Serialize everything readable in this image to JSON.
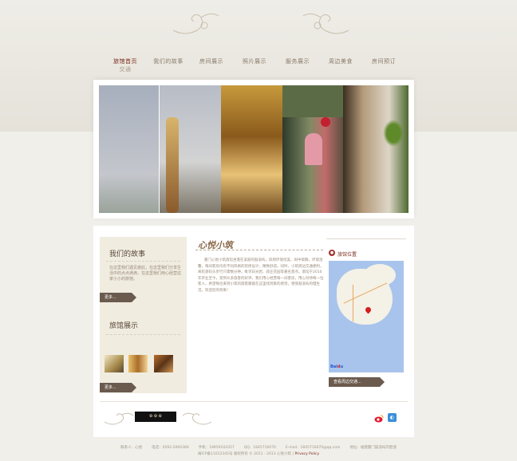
{
  "nav": {
    "items": [
      {
        "label": "旅馆首页",
        "sub": "交通"
      },
      {
        "label": "我们的故事",
        "sub": ""
      },
      {
        "label": "房间展示",
        "sub": ""
      },
      {
        "label": "照片展示",
        "sub": ""
      },
      {
        "label": "服务展示",
        "sub": ""
      },
      {
        "label": "周边美食",
        "sub": ""
      },
      {
        "label": "房间预订",
        "sub": ""
      }
    ]
  },
  "sidebar": {
    "story_title": "我们的故事",
    "story_text": "在这里我们遇见彼此，在这里我们分享生活中的点点滴滴，在这里我们用心经营这家小小的旅馆。",
    "more_label_1": "更多...",
    "rooms_title": "旅馆展示",
    "more_label_2": "更多..."
  },
  "main": {
    "title": "心悦小筑",
    "text": "厦门心悦小筑旅馆坐落在美丽的鼓浪屿，四周环境优美，闹中取静。环境温馨，每间客房均有不同风格的装修设计，精致舒适。同时，小筑周边交通便利，离轮渡码头步行只需数分钟。毗邻日光岩、菽庄花园等著名景点。旅馆于2010年开业至今，受到众多旅客的好评。我们用心经营每一间客房，用心对待每一位客人，希望每位来到小筑的旅客都能在这里找到家的感觉，感受鼓浪屿的慢生活。欢迎您的到来！"
  },
  "location": {
    "title": "旅馆位置",
    "route_label": "查看周边交通..."
  },
  "footer": {
    "line1": [
      "联系人：心悦",
      "电话：0592-2060366",
      "手机：18959104357",
      "QQ：1845716070",
      "E-mail：1845716070@qq.com",
      "地址：福建厦门鼓浪屿内厝澳"
    ],
    "line2_prefix": "闽ICP备11012345号 版权所有 © 2011 - 2013 心悦小筑",
    "privacy": "Privacy Policy"
  },
  "icons": {
    "weibo": "weibo-icon",
    "qq": "qq-icon"
  }
}
